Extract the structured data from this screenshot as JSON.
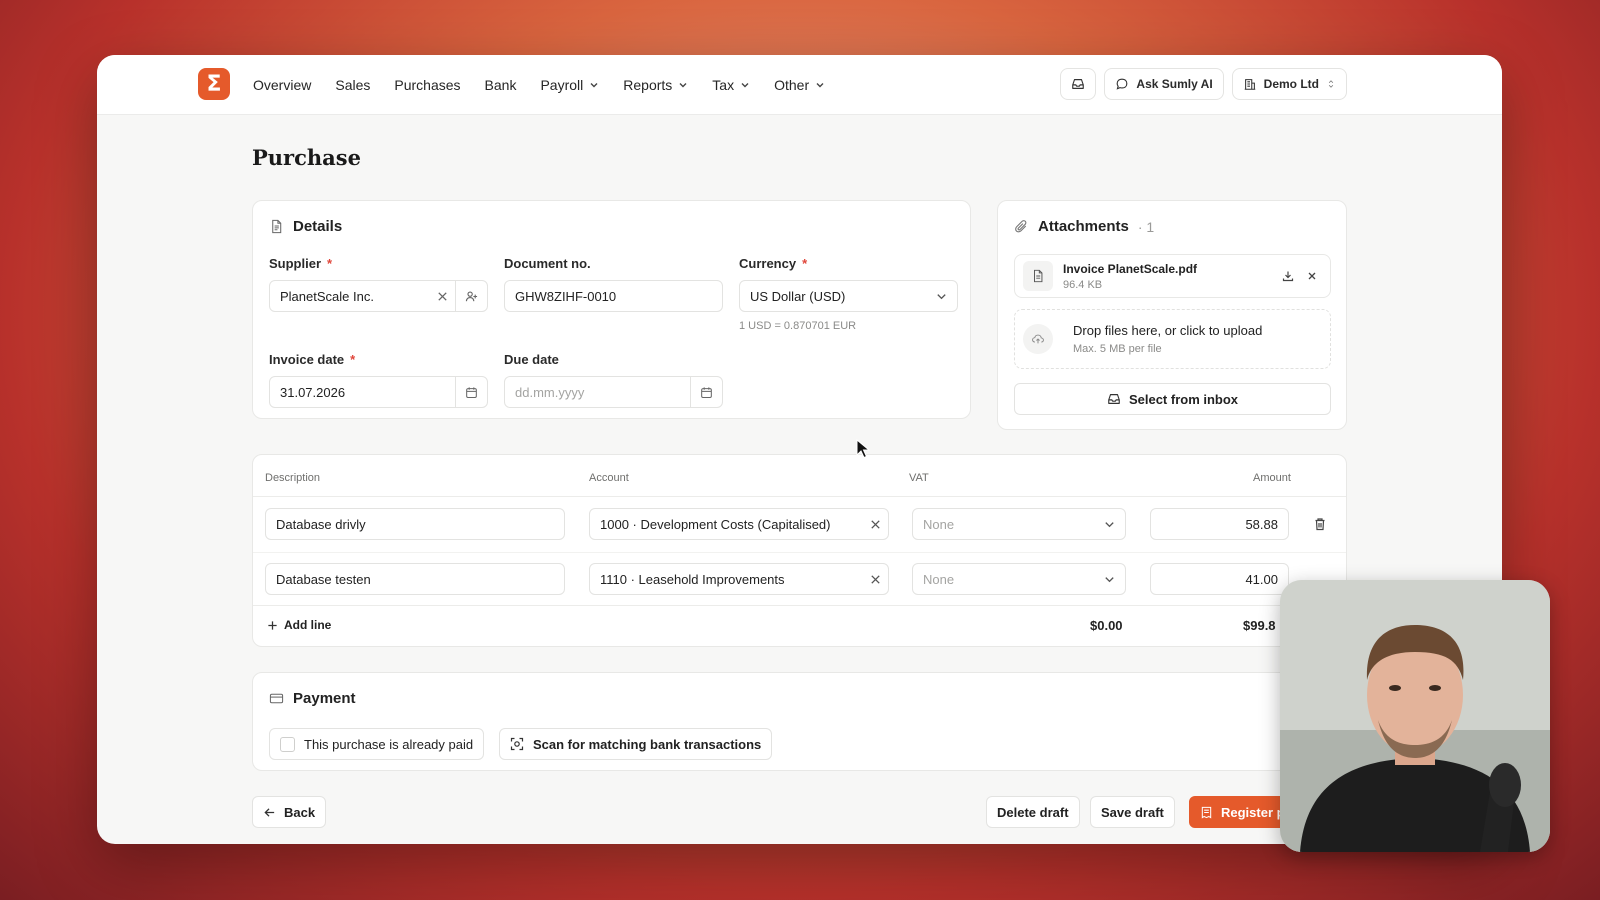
{
  "app": {
    "logo_glyph": "Σ",
    "accent_color": "#e55a2b"
  },
  "nav": {
    "items": [
      {
        "label": "Overview",
        "dropdown": false
      },
      {
        "label": "Sales",
        "dropdown": false
      },
      {
        "label": "Purchases",
        "dropdown": false
      },
      {
        "label": "Bank",
        "dropdown": false
      },
      {
        "label": "Payroll",
        "dropdown": true
      },
      {
        "label": "Reports",
        "dropdown": true
      },
      {
        "label": "Tax",
        "dropdown": true
      },
      {
        "label": "Other",
        "dropdown": true
      }
    ],
    "inbox_icon": "inbox-icon",
    "ask_ai_label": "Ask Sumly AI",
    "company_label": "Demo Ltd"
  },
  "page": {
    "title": "Purchase"
  },
  "details": {
    "title": "Details",
    "supplier": {
      "label": "Supplier",
      "required_mark": "*",
      "value": "PlanetScale Inc."
    },
    "document_no": {
      "label": "Document no.",
      "value": "GHW8ZIHF-0010"
    },
    "currency": {
      "label": "Currency",
      "required_mark": "*",
      "value": "US Dollar (USD)",
      "rate_hint": "1 USD = 0.870701 EUR"
    },
    "invoice_date": {
      "label": "Invoice date",
      "required_mark": "*",
      "value": "31.07.2026"
    },
    "due_date": {
      "label": "Due date",
      "placeholder": "dd.mm.yyyy"
    }
  },
  "attachments": {
    "title": "Attachments",
    "count_text": "· 1",
    "files": [
      {
        "name": "Invoice PlanetScale.pdf",
        "size": "96.4 KB"
      }
    ],
    "drop_main": "Drop files here, or click to upload",
    "drop_sub": "Max. 5 MB per file",
    "inbox_button": "Select from inbox"
  },
  "lines": {
    "headers": {
      "description": "Description",
      "account": "Account",
      "vat": "VAT",
      "amount": "Amount"
    },
    "rows": [
      {
        "description": "Database drivly",
        "account": "1000 · Development Costs (Capitalised)",
        "vat": "None",
        "amount": "58.88"
      },
      {
        "description": "Database testen",
        "account": "1110 · Leasehold Improvements",
        "vat": "None",
        "amount": "41.00"
      }
    ],
    "add_line": "Add line",
    "vat_total": "$0.00",
    "amount_total": "$99.8"
  },
  "payment": {
    "title": "Payment",
    "already_paid_label": "This purchase is already paid",
    "scan_label": "Scan for matching bank transactions"
  },
  "footer": {
    "back": "Back",
    "delete_draft": "Delete draft",
    "save_draft": "Save draft",
    "register": "Register p"
  }
}
